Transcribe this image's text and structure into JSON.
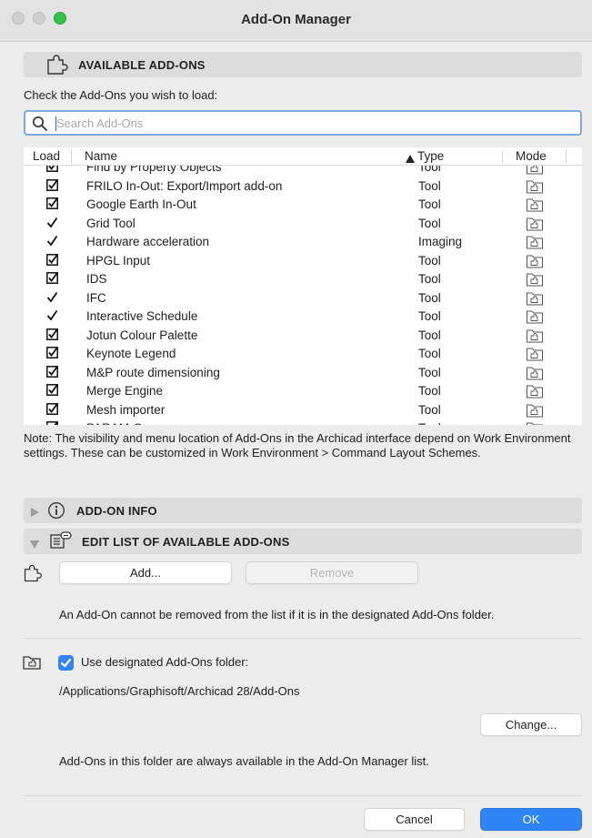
{
  "window": {
    "title": "Add-On Manager"
  },
  "available": {
    "header": "AVAILABLE ADD-ONS",
    "instruction": "Check the Add-Ons you wish to load:",
    "search_placeholder": "Search Add-Ons",
    "columns": {
      "load": "Load",
      "name": "Name",
      "type": "Type",
      "mode": "Mode"
    },
    "rows": [
      {
        "load": "checkbox",
        "name": "Find by Property Objects",
        "type": "Tool"
      },
      {
        "load": "checkbox",
        "name": "FRILO In-Out: Export/Import add-on",
        "type": "Tool"
      },
      {
        "load": "checkbox",
        "name": "Google Earth In-Out",
        "type": "Tool"
      },
      {
        "load": "check",
        "name": "Grid Tool",
        "type": "Tool"
      },
      {
        "load": "check",
        "name": "Hardware acceleration",
        "type": "Imaging"
      },
      {
        "load": "checkbox",
        "name": "HPGL Input",
        "type": "Tool"
      },
      {
        "load": "checkbox",
        "name": "IDS",
        "type": "Tool"
      },
      {
        "load": "check",
        "name": "IFC",
        "type": "Tool"
      },
      {
        "load": "check",
        "name": "Interactive Schedule",
        "type": "Tool"
      },
      {
        "load": "checkbox",
        "name": "Jotun Colour Palette",
        "type": "Tool"
      },
      {
        "load": "checkbox",
        "name": "Keynote Legend",
        "type": "Tool"
      },
      {
        "load": "checkbox",
        "name": "M&P route dimensioning",
        "type": "Tool"
      },
      {
        "load": "checkbox",
        "name": "Merge Engine",
        "type": "Tool"
      },
      {
        "load": "checkbox",
        "name": "Mesh importer",
        "type": "Tool"
      },
      {
        "load": "checkbox",
        "name": "PARAM-O",
        "type": "Tool"
      }
    ],
    "note": "Note: The visibility and menu location of Add-Ons in the Archicad interface depend on Work Environment settings. These can be customized in Work Environment > Command Layout Schemes."
  },
  "info": {
    "header": "ADD-ON INFO"
  },
  "edit": {
    "header": "EDIT LIST OF AVAILABLE ADD-ONS",
    "add_label": "Add...",
    "remove_label": "Remove",
    "remove_note": "An Add-On cannot be removed from the list if it is in the designated Add-Ons folder.",
    "use_folder_label": "Use designated Add-Ons folder:",
    "use_folder_checked": true,
    "folder_path": "/Applications/Graphisoft/Archicad 28/Add-Ons",
    "change_label": "Change...",
    "folder_note": "Add-Ons in this folder are always available in the Add-On Manager list."
  },
  "footer": {
    "cancel_label": "Cancel",
    "ok_label": "OK"
  },
  "colors": {
    "accent": "#2f84f6",
    "traffic_green": "#35c24a",
    "header_bg": "#dcdcdc"
  }
}
